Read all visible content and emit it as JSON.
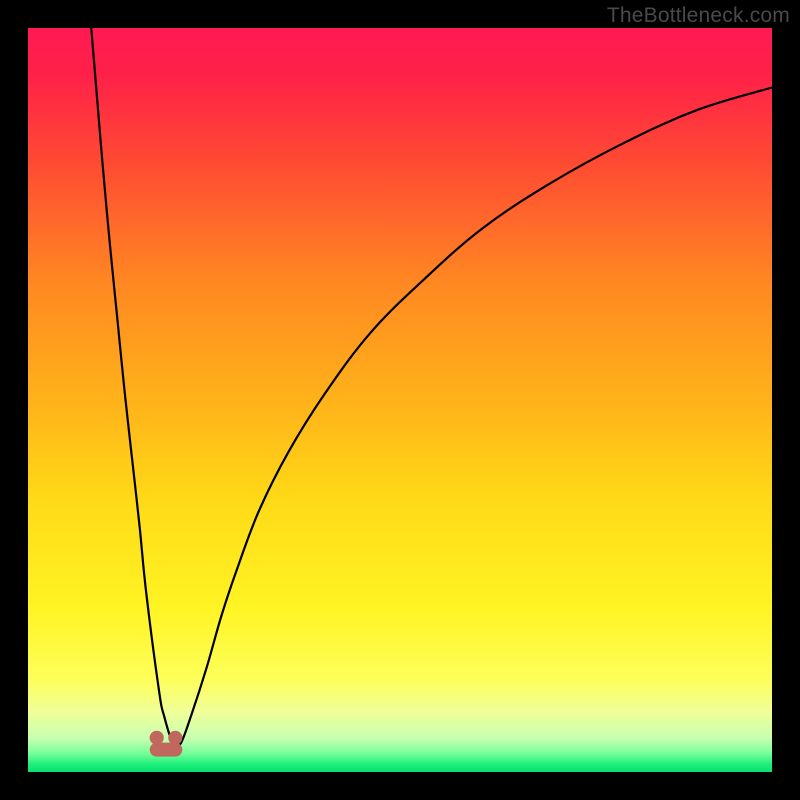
{
  "watermark": {
    "text": "TheBottleneck.com"
  },
  "chart_data": {
    "type": "line",
    "title": "",
    "xlabel": "",
    "ylabel": "",
    "xlim": [
      0,
      100
    ],
    "ylim": [
      0,
      100
    ],
    "background_gradient_stops": [
      {
        "offset": 0.0,
        "color": "#ff1a53"
      },
      {
        "offset": 0.06,
        "color": "#ff2049"
      },
      {
        "offset": 0.18,
        "color": "#ff4a33"
      },
      {
        "offset": 0.34,
        "color": "#ff8722"
      },
      {
        "offset": 0.5,
        "color": "#ffb21a"
      },
      {
        "offset": 0.64,
        "color": "#ffdb17"
      },
      {
        "offset": 0.78,
        "color": "#fff424"
      },
      {
        "offset": 0.875,
        "color": "#feff5a"
      },
      {
        "offset": 0.92,
        "color": "#f0ff99"
      },
      {
        "offset": 0.955,
        "color": "#c8ffb0"
      },
      {
        "offset": 0.975,
        "color": "#77ff99"
      },
      {
        "offset": 0.99,
        "color": "#1cef7a"
      },
      {
        "offset": 1.0,
        "color": "#0adf70"
      }
    ],
    "series": [
      {
        "name": "bottleneck-curve",
        "x": [
          8.5,
          9,
          10,
          11,
          12,
          13,
          14,
          15,
          15.9,
          17.6,
          18.3,
          19.5,
          20.5,
          22,
          24,
          26,
          28,
          31,
          35,
          40,
          46,
          53,
          61,
          70,
          80,
          90,
          100
        ],
        "y": [
          100,
          94,
          82,
          71,
          61,
          51,
          42,
          33,
          24,
          11,
          7.5,
          3.8,
          3.8,
          7.8,
          14,
          21,
          27,
          35,
          43,
          51,
          59,
          66,
          73,
          79,
          84.5,
          89,
          92
        ]
      }
    ],
    "markers": [
      {
        "name": "cusp-left",
        "x": 17.3,
        "y": 4.6,
        "r": 0.95,
        "color": "#c1685e"
      },
      {
        "name": "cusp-right",
        "x": 19.8,
        "y": 4.6,
        "r": 0.95,
        "color": "#c1685e"
      }
    ],
    "cusp_connector": {
      "from_x": 17.3,
      "to_x": 19.8,
      "y": 3.0,
      "color": "#c1685e",
      "width": 1.9
    }
  }
}
